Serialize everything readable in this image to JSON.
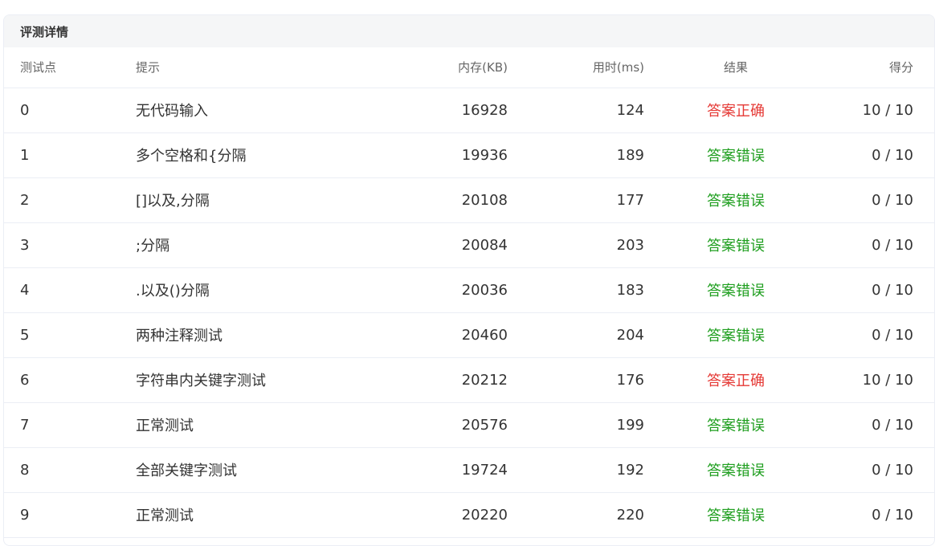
{
  "panel": {
    "title": "评测详情"
  },
  "table": {
    "headers": {
      "id": "测试点",
      "hint": "提示",
      "memory": "内存(KB)",
      "time": "用时(ms)",
      "result": "结果",
      "score": "得分"
    },
    "rows": [
      {
        "id": "0",
        "hint": "无代码输入",
        "memory": "16928",
        "time": "124",
        "result": "答案正确",
        "score": "10 / 10"
      },
      {
        "id": "1",
        "hint": "多个空格和{分隔",
        "memory": "19936",
        "time": "189",
        "result": "答案错误",
        "score": "0 / 10"
      },
      {
        "id": "2",
        "hint": "[]以及,分隔",
        "memory": "20108",
        "time": "177",
        "result": "答案错误",
        "score": "0 / 10"
      },
      {
        "id": "3",
        "hint": ";分隔",
        "memory": "20084",
        "time": "203",
        "result": "答案错误",
        "score": "0 / 10"
      },
      {
        "id": "4",
        "hint": ".以及()分隔",
        "memory": "20036",
        "time": "183",
        "result": "答案错误",
        "score": "0 / 10"
      },
      {
        "id": "5",
        "hint": "两种注释测试",
        "memory": "20460",
        "time": "204",
        "result": "答案错误",
        "score": "0 / 10"
      },
      {
        "id": "6",
        "hint": "字符串内关键字测试",
        "memory": "20212",
        "time": "176",
        "result": "答案正确",
        "score": "10 / 10"
      },
      {
        "id": "7",
        "hint": "正常测试",
        "memory": "20576",
        "time": "199",
        "result": "答案错误",
        "score": "0 / 10"
      },
      {
        "id": "8",
        "hint": "全部关键字测试",
        "memory": "19724",
        "time": "192",
        "result": "答案错误",
        "score": "0 / 10"
      },
      {
        "id": "9",
        "hint": "正常测试",
        "memory": "20220",
        "time": "220",
        "result": "答案错误",
        "score": "0 / 10"
      }
    ]
  },
  "colors": {
    "accepted": "#e53935",
    "wrong_answer": "#1e9e1e"
  }
}
